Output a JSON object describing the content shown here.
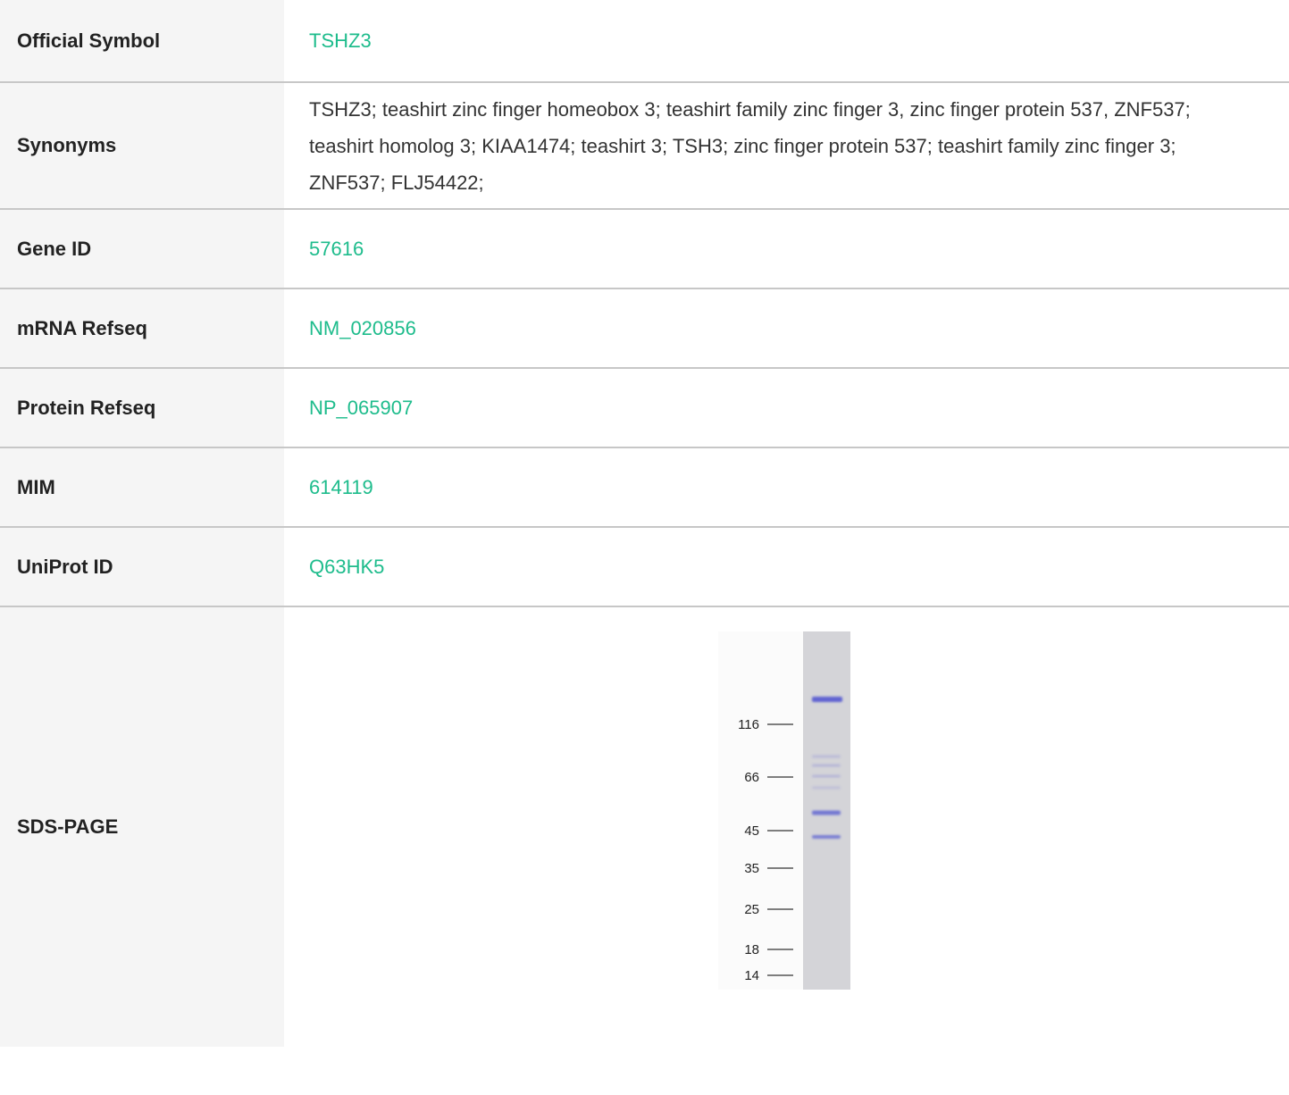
{
  "rows": [
    {
      "label": "Official Symbol",
      "value": "TSHZ3",
      "link": true
    },
    {
      "label": "Synonyms",
      "value": "TSHZ3; teashirt zinc finger homeobox 3; teashirt family zinc finger 3, zinc finger protein 537, ZNF537; teashirt homolog 3; KIAA1474; teashirt 3; TSH3; zinc finger protein 537; teashirt family zinc finger 3; ZNF537; FLJ54422;",
      "link": false
    },
    {
      "label": "Gene ID",
      "value": "57616",
      "link": true
    },
    {
      "label": "mRNA Refseq",
      "value": "NM_020856",
      "link": true
    },
    {
      "label": "Protein Refseq",
      "value": "NP_065907",
      "link": true
    },
    {
      "label": "MIM",
      "value": "614119",
      "link": true
    },
    {
      "label": "UniProt ID",
      "value": "Q63HK5",
      "link": true
    },
    {
      "label": "SDS-PAGE"
    }
  ],
  "gel": {
    "markers": [
      "116",
      "66",
      "45",
      "35",
      "25",
      "18",
      "14"
    ],
    "lane_color": "#d4d4d8",
    "band_color": "#4a4fd0"
  },
  "colors": {
    "link": "#1ebc8c",
    "label_bg": "#f5f5f5",
    "divider": "#c7c7c7"
  }
}
